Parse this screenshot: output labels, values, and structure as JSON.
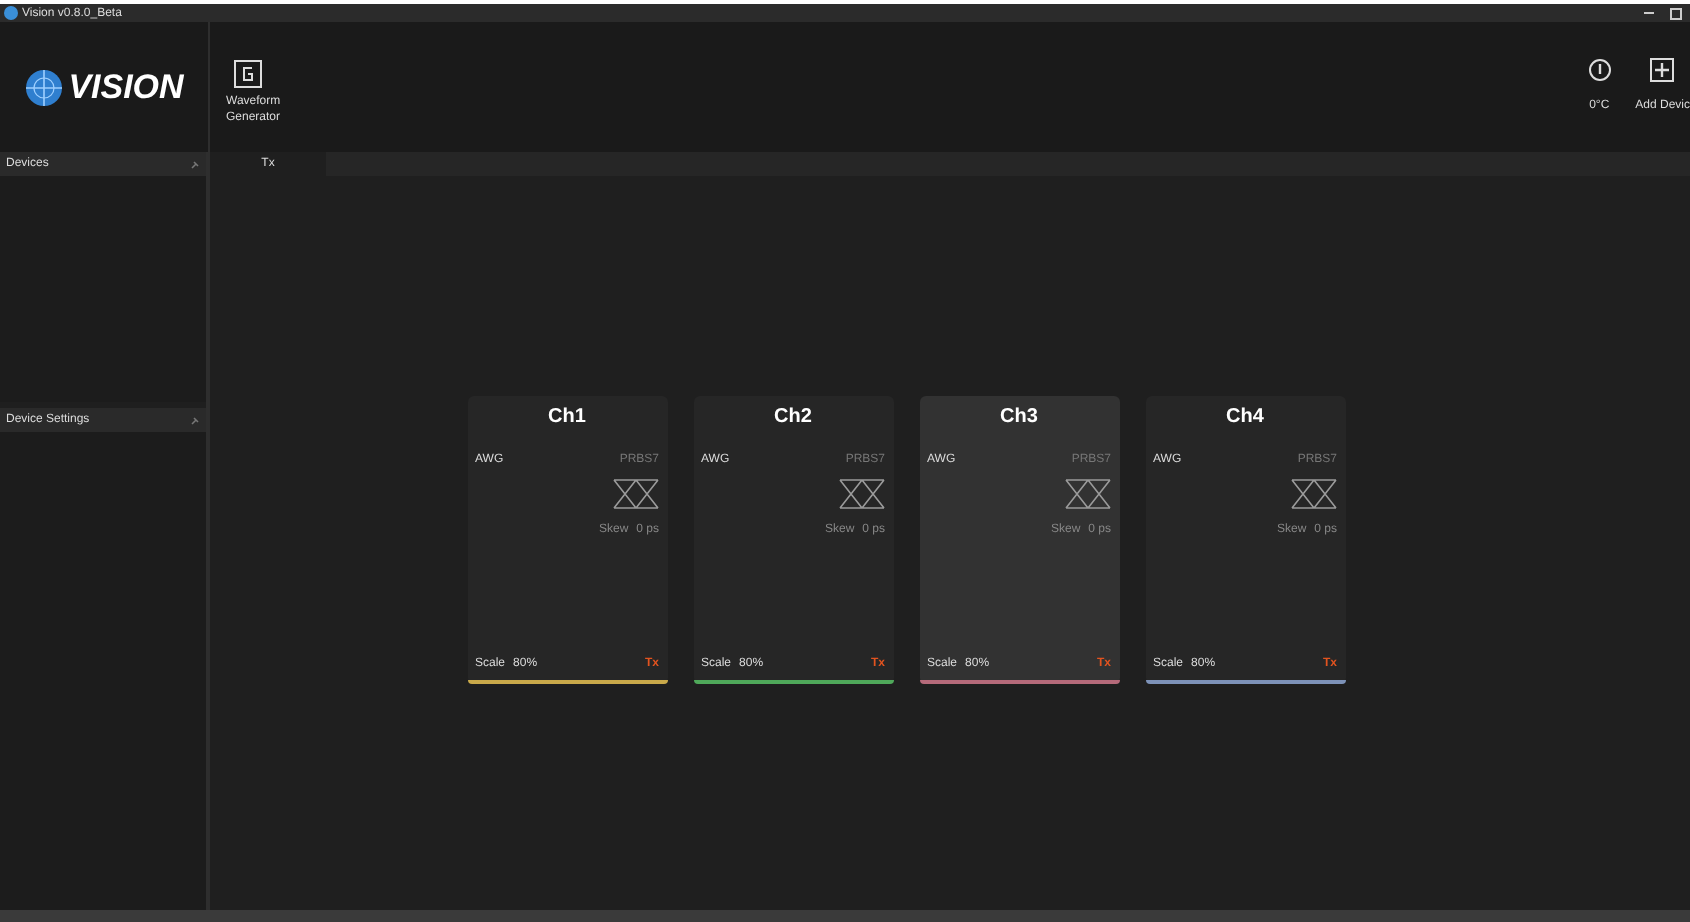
{
  "window": {
    "title": "Vision v0.8.0_Beta"
  },
  "toolbar": {
    "logo": "VISION",
    "tools": [
      {
        "label": "Waveform Generator"
      }
    ],
    "right": [
      {
        "kind": "info",
        "label": "0°C"
      },
      {
        "kind": "add",
        "label": "Add Devic"
      }
    ]
  },
  "sidebar": {
    "panels": [
      {
        "title": "Devices"
      },
      {
        "title": "Device Settings"
      }
    ]
  },
  "tabs": [
    {
      "label": "Tx",
      "selected": true
    }
  ],
  "channels": [
    {
      "name": "Ch1",
      "source": "AWG",
      "pattern": "PRBS7",
      "skew": "Skew",
      "skew_value": "0 ps",
      "scale": "Scale",
      "scale_value": "80%",
      "mode": "Tx",
      "color": "#c9a94a",
      "selected": false
    },
    {
      "name": "Ch2",
      "source": "AWG",
      "pattern": "PRBS7",
      "skew": "Skew",
      "skew_value": "0 ps",
      "scale": "Scale",
      "scale_value": "80%",
      "mode": "Tx",
      "color": "#4fa85a",
      "selected": false
    },
    {
      "name": "Ch3",
      "source": "AWG",
      "pattern": "PRBS7",
      "skew": "Skew",
      "skew_value": "0 ps",
      "scale": "Scale",
      "scale_value": "80%",
      "mode": "Tx",
      "color": "#b56a7a",
      "selected": true
    },
    {
      "name": "Ch4",
      "source": "AWG",
      "pattern": "PRBS7",
      "skew": "Skew",
      "skew_value": "0 ps",
      "scale": "Scale",
      "scale_value": "80%",
      "mode": "Tx",
      "color": "#7d92b8",
      "selected": false
    }
  ]
}
